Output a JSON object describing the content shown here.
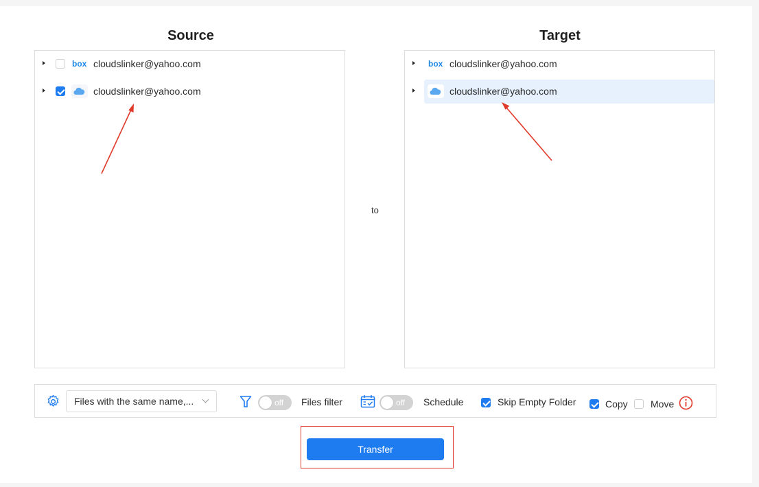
{
  "source": {
    "title": "Source",
    "items": [
      {
        "icon": "box-logo-icon",
        "label": "cloudslinker@yahoo.com",
        "checked": false
      },
      {
        "icon": "icloud-icon",
        "label": "cloudslinker@yahoo.com",
        "checked": true
      }
    ]
  },
  "connector": {
    "label": "to"
  },
  "target": {
    "title": "Target",
    "items": [
      {
        "icon": "box-logo-icon",
        "label": "cloudslinker@yahoo.com",
        "selected": false
      },
      {
        "icon": "icloud-icon",
        "label": "cloudslinker@yahoo.com",
        "selected": true
      }
    ]
  },
  "options": {
    "conflict_select": "Files with the same name,...",
    "files_filter": {
      "label": "Files filter",
      "state": "off"
    },
    "schedule": {
      "label": "Schedule",
      "state": "off"
    },
    "skip_empty_folder": {
      "label": "Skip Empty Folder",
      "checked": true
    },
    "copy": {
      "label": "Copy",
      "checked": true
    },
    "move": {
      "label": "Move",
      "checked": false
    }
  },
  "actions": {
    "transfer_label": "Transfer"
  },
  "colors": {
    "accent": "#1e7cf0",
    "annotation": "#e03a2a",
    "selected_row": "#e6f1fd",
    "box_brand": "#1e88e5"
  }
}
